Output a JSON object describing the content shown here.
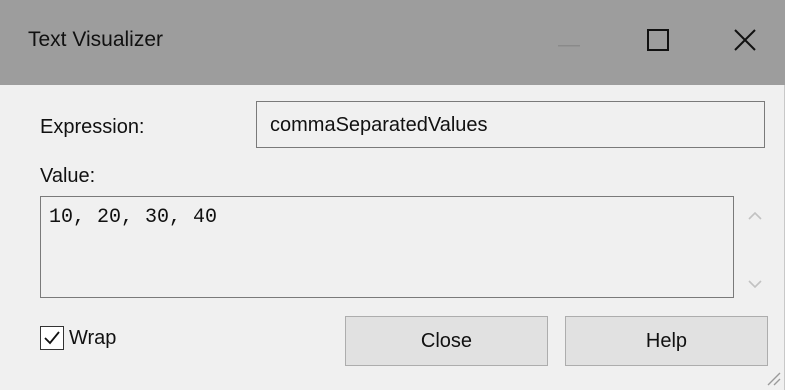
{
  "window": {
    "title": "Text Visualizer",
    "controls": {
      "minimize_icon": "minimize-icon",
      "maximize_icon": "maximize-icon",
      "close_icon": "close-icon"
    }
  },
  "expression": {
    "label": "Expression:",
    "value": "commaSeparatedValues"
  },
  "value": {
    "label": "Value:",
    "text": "10, 20, 30, 40"
  },
  "wrap": {
    "label": "Wrap",
    "checked": true
  },
  "buttons": {
    "close": "Close",
    "help": "Help"
  },
  "colors": {
    "titlebar": "#9d9d9d",
    "background": "#f0f0f0",
    "button": "#e1e1e1"
  }
}
